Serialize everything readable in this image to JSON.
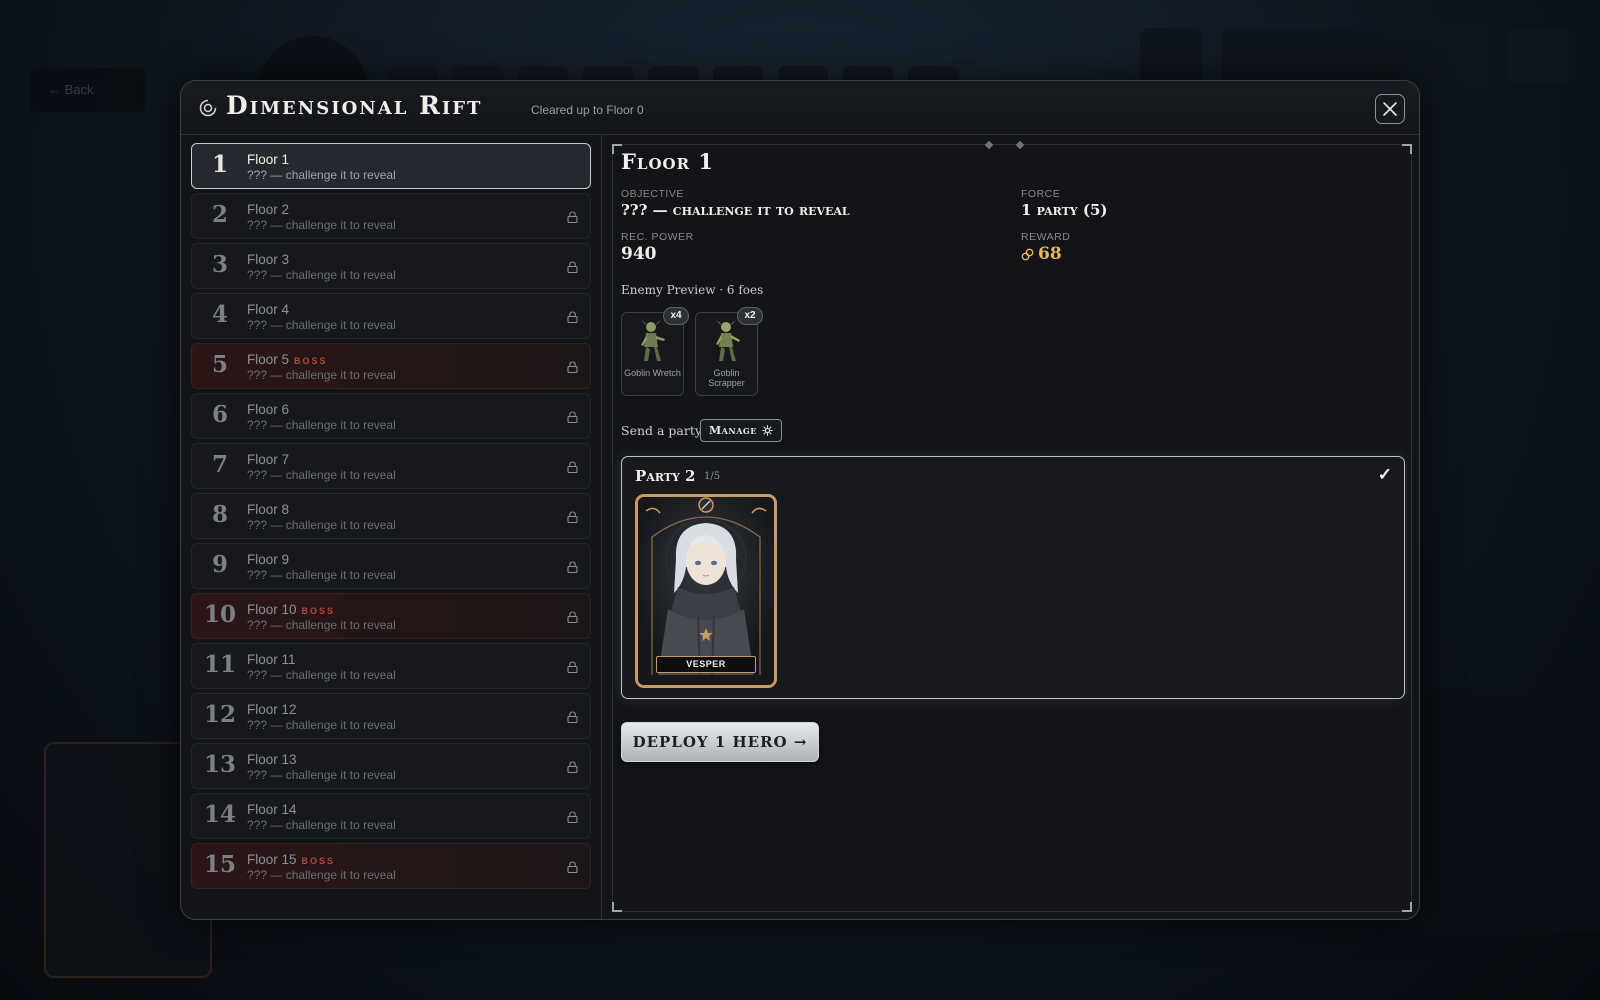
{
  "background": {
    "back_label": "← Back"
  },
  "modal": {
    "title": "Dimensional Rift",
    "subtitle": "Cleared up to Floor 0"
  },
  "floors": [
    {
      "num": "1",
      "name": "Floor 1",
      "boss": "",
      "desc": "??? — challenge it to reveal",
      "locked": false,
      "active": true
    },
    {
      "num": "2",
      "name": "Floor 2",
      "boss": "",
      "desc": "??? — challenge it to reveal",
      "locked": true,
      "active": false
    },
    {
      "num": "3",
      "name": "Floor 3",
      "boss": "",
      "desc": "??? — challenge it to reveal",
      "locked": true,
      "active": false
    },
    {
      "num": "4",
      "name": "Floor 4",
      "boss": "",
      "desc": "??? — challenge it to reveal",
      "locked": true,
      "active": false
    },
    {
      "num": "5",
      "name": "Floor 5",
      "boss": "BOSS",
      "desc": "??? — challenge it to reveal",
      "locked": true,
      "active": false
    },
    {
      "num": "6",
      "name": "Floor 6",
      "boss": "",
      "desc": "??? — challenge it to reveal",
      "locked": true,
      "active": false
    },
    {
      "num": "7",
      "name": "Floor 7",
      "boss": "",
      "desc": "??? — challenge it to reveal",
      "locked": true,
      "active": false
    },
    {
      "num": "8",
      "name": "Floor 8",
      "boss": "",
      "desc": "??? — challenge it to reveal",
      "locked": true,
      "active": false
    },
    {
      "num": "9",
      "name": "Floor 9",
      "boss": "",
      "desc": "??? — challenge it to reveal",
      "locked": true,
      "active": false
    },
    {
      "num": "10",
      "name": "Floor 10",
      "boss": "BOSS",
      "desc": "??? — challenge it to reveal",
      "locked": true,
      "active": false
    },
    {
      "num": "11",
      "name": "Floor 11",
      "boss": "",
      "desc": "??? — challenge it to reveal",
      "locked": true,
      "active": false
    },
    {
      "num": "12",
      "name": "Floor 12",
      "boss": "",
      "desc": "??? — challenge it to reveal",
      "locked": true,
      "active": false
    },
    {
      "num": "13",
      "name": "Floor 13",
      "boss": "",
      "desc": "??? — challenge it to reveal",
      "locked": true,
      "active": false
    },
    {
      "num": "14",
      "name": "Floor 14",
      "boss": "",
      "desc": "??? — challenge it to reveal",
      "locked": true,
      "active": false
    },
    {
      "num": "15",
      "name": "Floor 15",
      "boss": "BOSS",
      "desc": "??? — challenge it to reveal",
      "locked": true,
      "active": false
    }
  ],
  "detail": {
    "title": "Floor 1",
    "objective_label": "Objective",
    "objective_value": "??? — challenge it to reveal",
    "force_label": "Force",
    "force_value": "1 party (5)",
    "power_label": "Rec. Power",
    "power_value": "940",
    "reward_label": "Reward",
    "reward_value": "68",
    "enemy_preview_label": "Enemy Preview · 6 foes",
    "enemies": [
      {
        "name": "Goblin Wretch",
        "count": "x4"
      },
      {
        "name": "Goblin Scrapper",
        "count": "x2"
      }
    ],
    "send_party_label": "Send a party",
    "manage_label": "Manage",
    "party": {
      "name": "Party 2",
      "count": "1/5",
      "check": "✓",
      "heroes": [
        {
          "name": "VESPER"
        }
      ]
    },
    "deploy_label": "DEPLOY 1 HERO →"
  },
  "colors": {
    "accent_gold": "#e7b65c",
    "boss_red": "#b9433d",
    "hero_frame": "#c99a62"
  }
}
